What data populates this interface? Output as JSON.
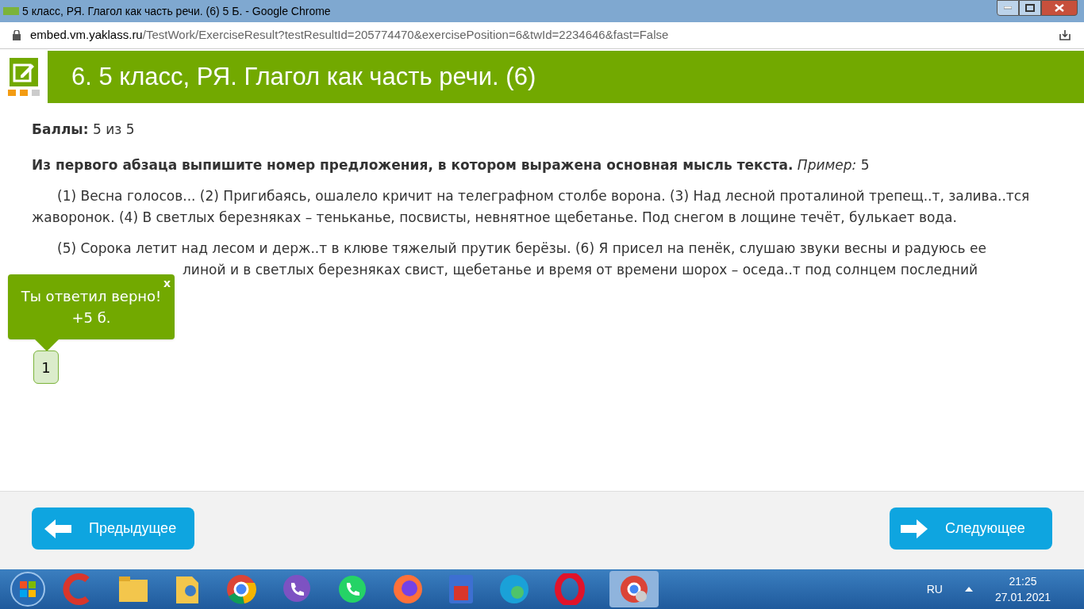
{
  "window": {
    "title": "5 класс, РЯ. Глагол как часть речи. (6) 5 Б. - Google Chrome"
  },
  "address_bar": {
    "host": "embed.vm.yaklass.ru",
    "path": "/TestWork/ExerciseResult?testResultId=205774470&exercisePosition=6&twId=2234646&fast=False"
  },
  "header": {
    "title": "6. 5 класс, РЯ. Глагол как часть речи. (6)"
  },
  "score": {
    "label": "Баллы:",
    "value": "5 из 5"
  },
  "task": {
    "question": "**Из первого абзаца выпишите номер предложения, в котором выражена основная мысль текста.** *Пример:* 5",
    "paragraphs": [
      {
        "lines": [
          "(1) Весна голосов... (2) Пригибаясь, ошалело кричит на телеграфном столбе ворона. (3) Над лесной проталиной трепещ..т, залива..тся жаворонок. (4) В светлых березняках – теньканье, посвисты, невнятное щебетанье. Под снегом в лощине течёт, булькает вода."
        ]
      },
      {
        "lines": [
          "(5) Сорока летит над лесом и держ..т в клюве тяжелый прутик берёзы. (6) Я присел на пенёк, слушаю звуки весны и радуюсь ее",
          "линой и в светлых березняках свист, щебетанье и время от времени шорох – оседа..т под солнцем последний"
        ]
      }
    ]
  },
  "feedback": {
    "close": "x",
    "message": "Ты ответил верно!",
    "points": "+5 б."
  },
  "answer": {
    "value": "1",
    "correct": true
  },
  "nav": [
    {
      "kind": "prev",
      "label": "Предыдущее"
    },
    {
      "kind": "next",
      "label": "Следующее"
    }
  ],
  "taskbar": {
    "language": "RU",
    "time": "21:25",
    "date": "27.01.2021"
  }
}
